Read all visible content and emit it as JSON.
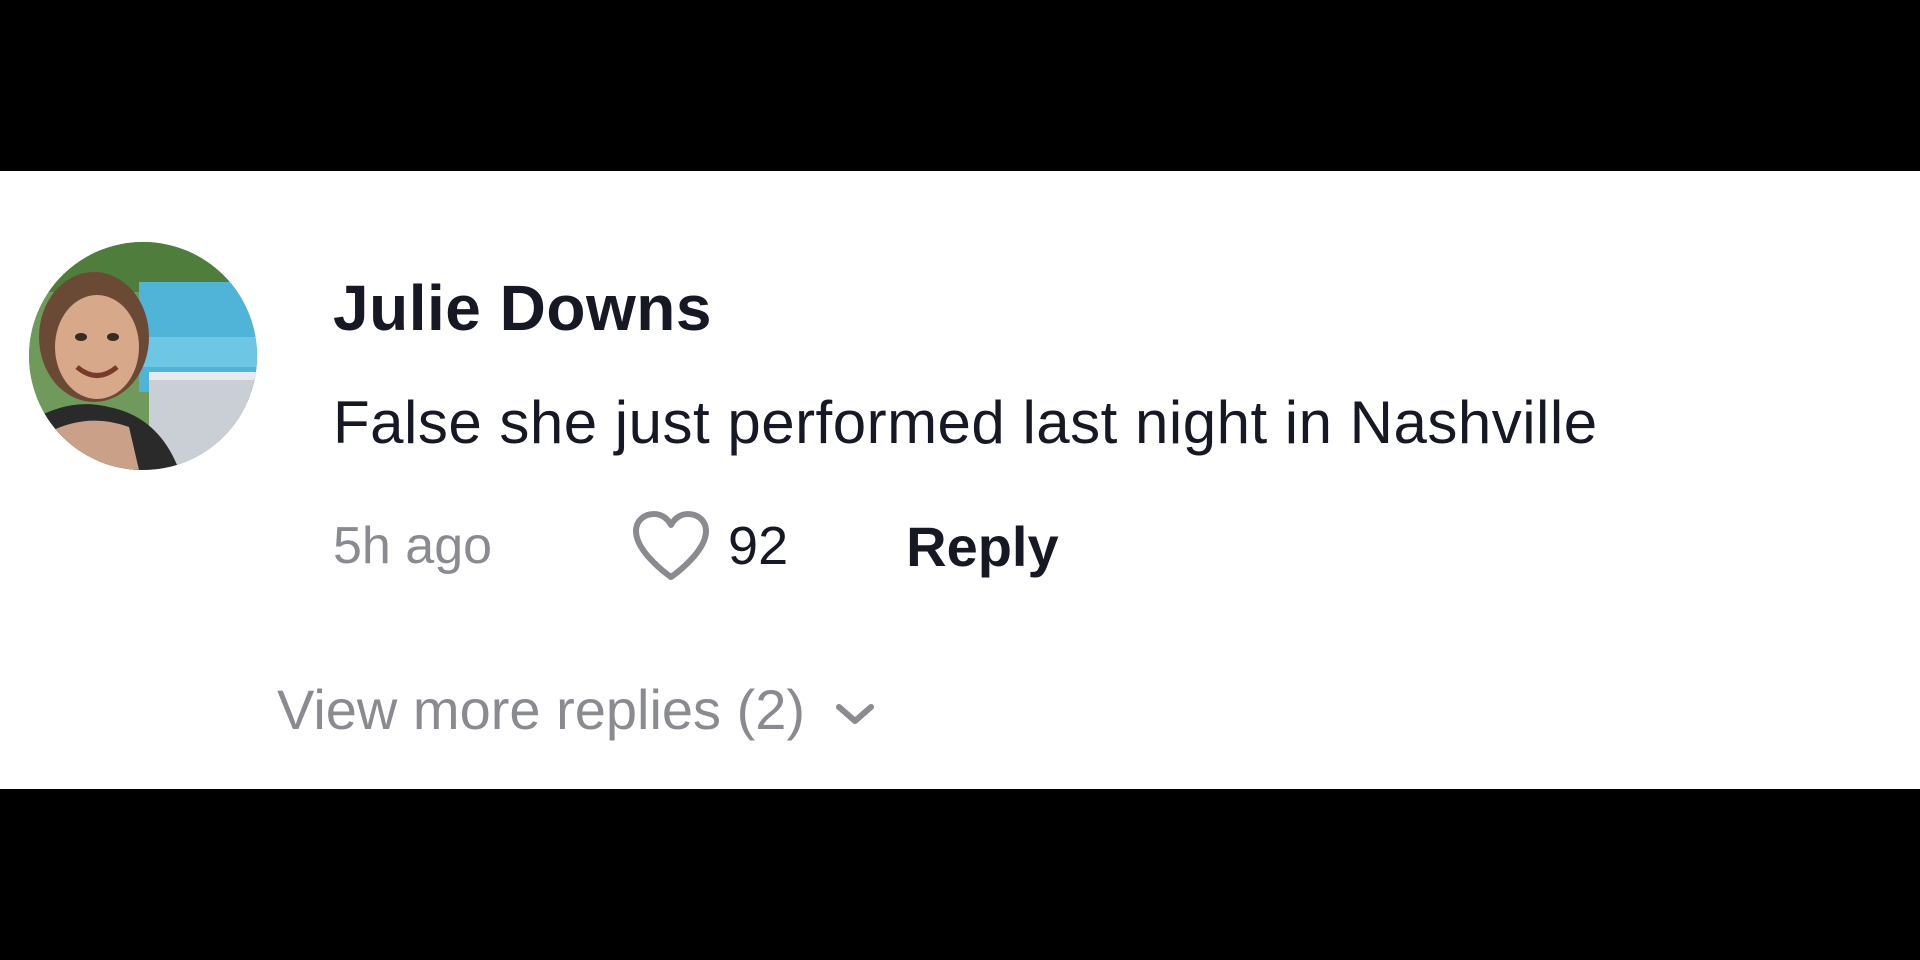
{
  "comment": {
    "username": "Julie Downs",
    "text": "False she just performed last night in Nashville",
    "timestamp": "5h ago",
    "likes": "92",
    "reply_label": "Reply",
    "avatar_icon": "user-avatar-photo",
    "like_icon": "heart-outline-icon"
  },
  "replies": {
    "view_more_label": "View more replies (2)",
    "expand_icon": "chevron-down-icon"
  },
  "colors": {
    "primary_text": "#161823",
    "secondary_text": "#8a8b91",
    "background": "#ffffff",
    "letterbox": "#000000"
  }
}
